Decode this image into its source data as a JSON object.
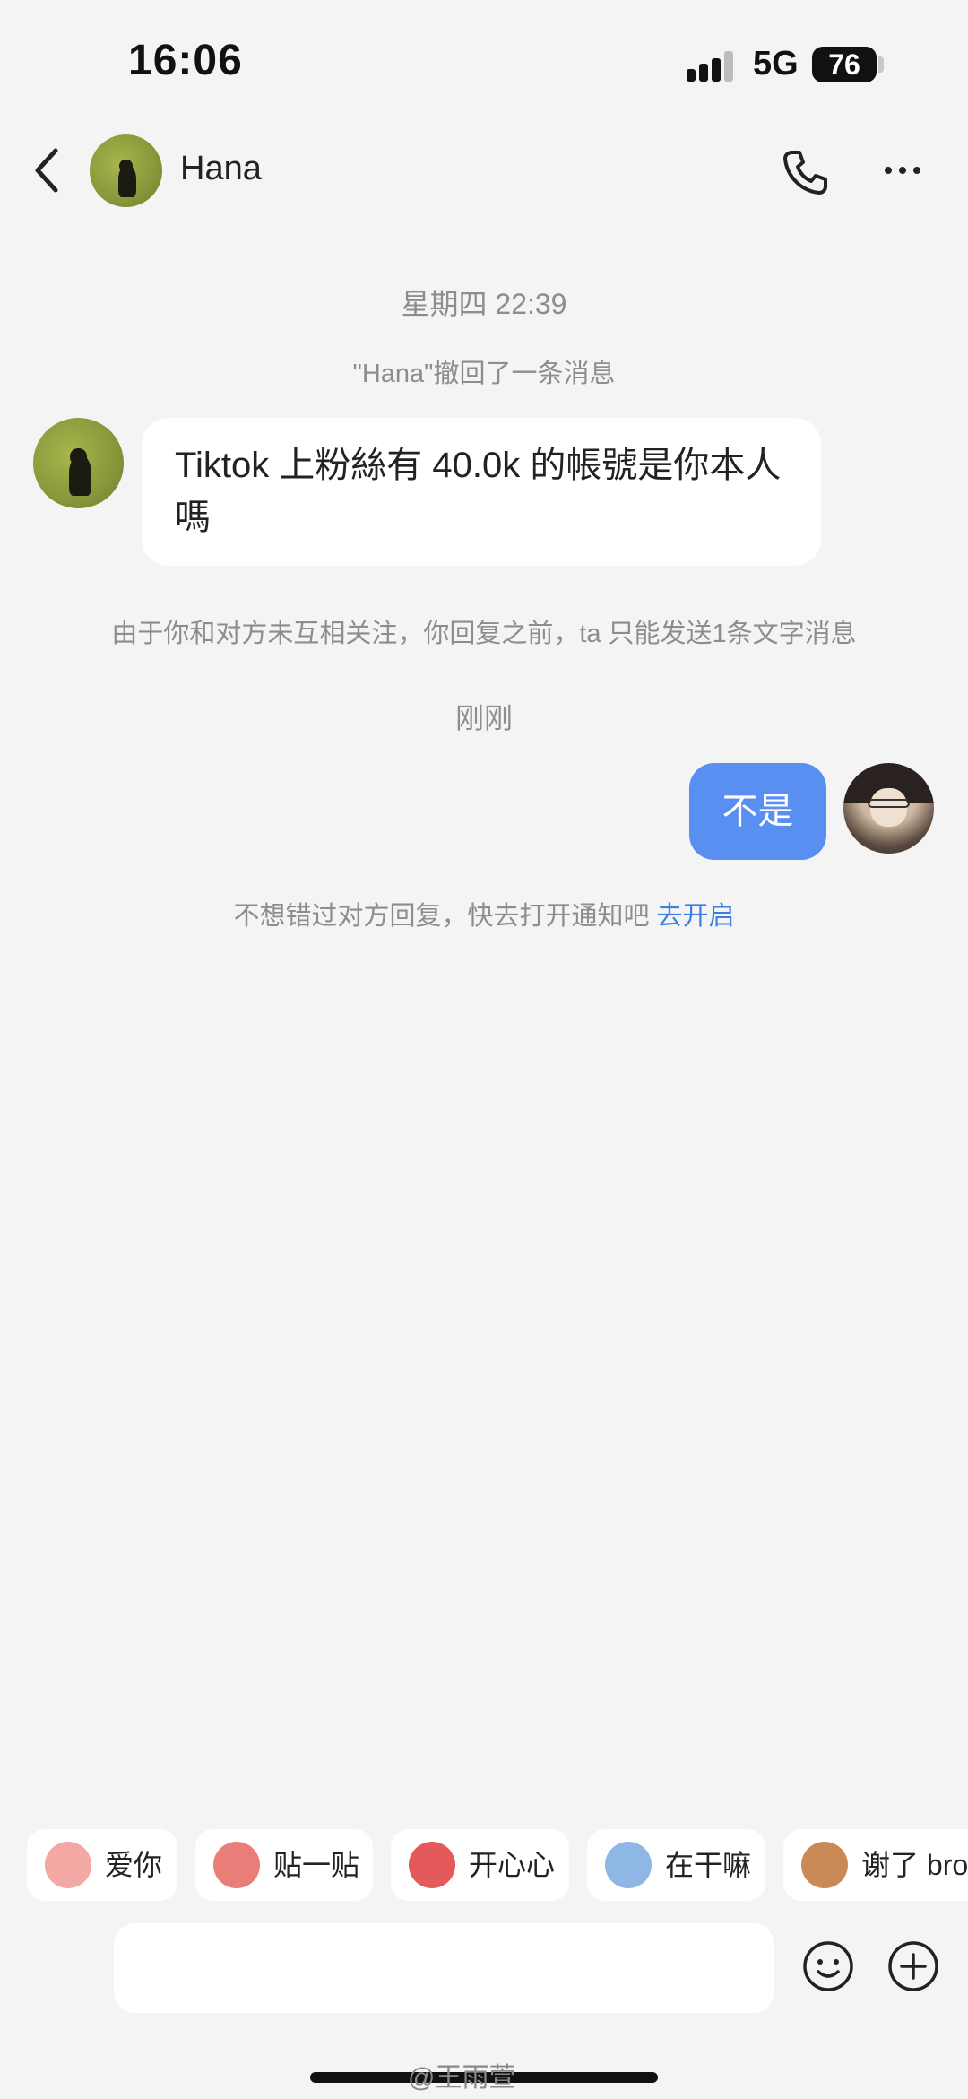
{
  "status_bar": {
    "time": "16:06",
    "network": "5G",
    "battery": "76"
  },
  "header": {
    "contact_name": "Hana"
  },
  "conversation": {
    "timestamp_1": "星期四 22:39",
    "recall_notice": "\"Hana\"撤回了一条消息",
    "incoming_message": "Tiktok 上粉絲有 40.0k 的帳號是你本人嗎",
    "limit_notice": "由于你和对方未互相关注，你回复之前，ta 只能发送1条文字消息",
    "timestamp_2": "刚刚",
    "outgoing_message": "不是",
    "notification_prompt": "不想错过对方回复，快去打开通知吧",
    "notification_link": "去开启"
  },
  "quick_replies": [
    {
      "label": "爱你",
      "sticker_color": "#f3a8a3"
    },
    {
      "label": "贴一贴",
      "sticker_color": "#e97e78"
    },
    {
      "label": "开心心",
      "sticker_color": "#e45a5a"
    },
    {
      "label": "在干嘛",
      "sticker_color": "#8fb7e6"
    },
    {
      "label": "谢了 bro",
      "sticker_color": "#c98a55"
    }
  ],
  "watermark": "@王雨萱"
}
